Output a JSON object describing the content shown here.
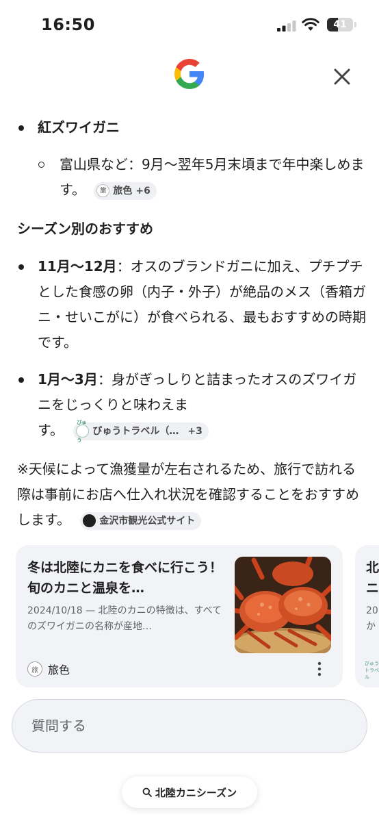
{
  "status_bar": {
    "time": "16:50",
    "battery": "41",
    "battery_level": 0.41
  },
  "answer": {
    "item_zuwai": "紅ズワイガニ",
    "sub_item_text": "富山県など：9月～翌年5月末頃まで年中楽しめます。",
    "chip1": {
      "label": "旅色",
      "count": "+6",
      "icon": "tabiiro-logo-icon"
    },
    "season_heading": "シーズン別のおすすめ",
    "bullet2": {
      "bold": "11月～12月",
      "text": "：オスのブランドガニに加え、プチプチとした食感の卵（内子・外子）が絶品のメス（香箱ガニ・せいこがに）が食べられる、最もおすすめの時期です。"
    },
    "bullet3": {
      "bold": "1月～3月",
      "text": "：身がぎっしりと詰まったオスのズワイガニをじっくりと味わえま",
      "tail": "す。"
    },
    "chip2": {
      "label": "びゅうトラベル（…",
      "count": "+3",
      "icon": "view-travel-logo-icon"
    },
    "note": "※天候によって漁獲量が左右されるため、旅行で訪れる際は事前にお店へ仕入れ状況を確認することをおすすめします。",
    "chip3": {
      "label": "金沢市観光公式サイト",
      "icon": "kanazawa-logo-icon"
    }
  },
  "cards": [
    {
      "title": "冬は北陸にカニを食べに行こう！旬のカニと温泉を…",
      "snippet": "2024/10/18 — 北陸のカニの特徴は、すべてのズワイガニの名称が産地…",
      "source": "旅色"
    },
    {
      "title": "北ニ",
      "snippet": "20か"
    }
  ],
  "ask": {
    "placeholder": "質問する"
  },
  "suggestion": {
    "label": "北陸カニシーズン"
  },
  "colors": {
    "google_blue": "#4285F4",
    "google_red": "#EA4335",
    "google_yellow": "#FBBC05",
    "google_green": "#34A853",
    "card_bg": "#f1f3f6",
    "chip_bg": "#eef0f3"
  }
}
